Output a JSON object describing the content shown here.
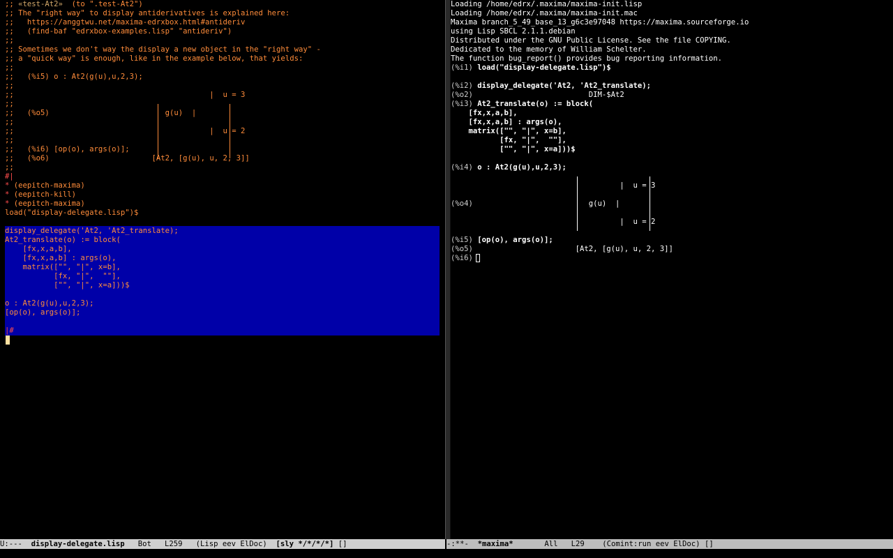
{
  "left": {
    "lines_top": [
      {
        "cls": "c-comment",
        "parts": [
          {
            "cls": "c-comment",
            "text": ";; "
          },
          {
            "cls": "c-green",
            "text": "«test-At2»"
          },
          {
            "cls": "c-comment",
            "text": "  (to \".test-At2\")"
          }
        ]
      },
      {
        "cls": "c-comment",
        "text": ";; The \"right way\" to display antiderivatives is explained here:"
      },
      {
        "cls": "c-comment",
        "text": ";;   https://anggtwu.net/maxima-edrxbox.html#antideriv"
      },
      {
        "cls": "c-comment",
        "text": ";;   (find-baf \"edrxbox-examples.lisp\" \"antideriv\")"
      },
      {
        "cls": "c-comment",
        "text": ";;"
      },
      {
        "cls": "c-comment",
        "text": ";; Sometimes we don't way the display a new object in the \"right way\" -"
      },
      {
        "cls": "c-comment",
        "text": ";; a \"quick way\" is enough, like in the example below, that yields:"
      },
      {
        "cls": "c-comment",
        "text": ";;"
      },
      {
        "cls": "c-comment",
        "text": ";;   (%i5) o : At2(g(u),u,2,3);"
      },
      {
        "cls": "c-comment",
        "text": ";;"
      },
      {
        "cls": "c-comment",
        "text": ";;                                            |  u = 3"
      },
      {
        "cls": "c-comment",
        "text": ";;"
      },
      {
        "cls": "c-comment",
        "text": ";;   (%o5)                          g(u)  |"
      },
      {
        "cls": "c-comment",
        "text": ";;"
      },
      {
        "cls": "c-comment",
        "text": ";;                                            |  u = 2"
      },
      {
        "cls": "c-comment",
        "text": ";;"
      },
      {
        "cls": "c-comment",
        "text": ";;   (%i6) [op(o), args(o)];"
      },
      {
        "cls": "c-comment",
        "text": ";;   (%o6)                       [At2, [g(u), u, 2, 3]]"
      },
      {
        "cls": "c-comment",
        "text": ";;"
      },
      {
        "cls": "c-red",
        "text": "#|"
      },
      {
        "cls": "c-red",
        "parts": [
          {
            "cls": "c-red",
            "text": "* "
          },
          {
            "cls": "c-comment",
            "text": "(eepitch-maxima)"
          }
        ]
      },
      {
        "cls": "c-red",
        "parts": [
          {
            "cls": "c-red",
            "text": "* "
          },
          {
            "cls": "c-comment",
            "text": "(eepitch-kill)"
          }
        ]
      },
      {
        "cls": "c-red",
        "parts": [
          {
            "cls": "c-red",
            "text": "* "
          },
          {
            "cls": "c-comment",
            "text": "(eepitch-maxima)"
          }
        ]
      }
    ],
    "lines_region": [
      "load(\"display-delegate.lisp\")$",
      "",
      "display_delegate('At2, 'At2_translate);",
      "At2_translate(o) := block(",
      "    [fx,x,a,b],",
      "    [fx,x,a,b] : args(o),",
      "    matrix([\"\", \"|\", x=b],",
      "           [fx, \"|\",  \"\"],",
      "           [\"\", \"|\", x=a]))$",
      "",
      "o : At2(g(u),u,2,3);",
      "[op(o), args(o)];"
    ],
    "lines_after": [
      "",
      "|#"
    ]
  },
  "right": {
    "lines": [
      {
        "cls": "c-text",
        "text": "Loading /home/edrx/.maxima/maxima-init.lisp"
      },
      {
        "cls": "c-text",
        "text": "Loading /home/edrx/.maxima/maxima-init.mac"
      },
      {
        "cls": "c-text",
        "text": "Maxima branch_5_49_base_13_g6c3e97048 https://maxima.sourceforge.io"
      },
      {
        "cls": "c-text",
        "text": "using Lisp SBCL 2.1.1.debian"
      },
      {
        "cls": "c-text",
        "text": "Distributed under the GNU Public License. See the file COPYING."
      },
      {
        "cls": "c-text",
        "text": "Dedicated to the memory of William Schelter."
      },
      {
        "cls": "c-text",
        "text": "The function bug_report() provides bug reporting information."
      },
      {
        "label": "(%i1) ",
        "bold": "load(\"display-delegate.lisp\")$"
      },
      {
        "cls": "c-text",
        "text": ""
      },
      {
        "label": "(%i2) ",
        "bold": "display_delegate('At2, 'At2_translate);"
      },
      {
        "label": "(%o2)                          ",
        "plain": "DIM-$At2"
      },
      {
        "label": "(%i3) ",
        "bold": "At2_translate(o) := block("
      },
      {
        "bold_only": "    [fx,x,a,b],"
      },
      {
        "bold_only": "    [fx,x,a,b] : args(o),"
      },
      {
        "bold_only": "    matrix([\"\", \"|\", x=b],"
      },
      {
        "bold_only": "           [fx, \"|\",  \"\"],"
      },
      {
        "bold_only": "           [\"\", \"|\", x=a]))$"
      },
      {
        "cls": "c-text",
        "text": ""
      },
      {
        "label": "(%i4) ",
        "bold": "o : At2(g(u),u,2,3);"
      },
      {
        "cls": "c-text",
        "text": ""
      },
      {
        "cls": "c-text",
        "text": "                                      |  u = 3"
      },
      {
        "cls": "c-text",
        "text": ""
      },
      {
        "label": "(%o4)                          ",
        "plain": "g(u)  |"
      },
      {
        "cls": "c-text",
        "text": ""
      },
      {
        "cls": "c-text",
        "text": "                                      |  u = 2"
      },
      {
        "cls": "c-text",
        "text": ""
      },
      {
        "label": "(%i5) ",
        "bold": "[op(o), args(o)];"
      },
      {
        "label": "(%o5)                       ",
        "plain": "[At2, [g(u), u, 2, 3]]"
      },
      {
        "label": "(%i6) ",
        "plain": ""
      }
    ]
  },
  "modeline_left": {
    "status": "U:---  ",
    "buffer": "display-delegate.lisp",
    "position": "   Bot   L259   ",
    "modes": "(Lisp eev ElDoc)  ",
    "sly": "[sly */*/*/*]",
    "tail": " []"
  },
  "modeline_right": {
    "status": "-:**-  ",
    "buffer": "*maxima*",
    "position": "       All   L29    ",
    "modes": "(Comint:run eev ElDoc) []"
  }
}
